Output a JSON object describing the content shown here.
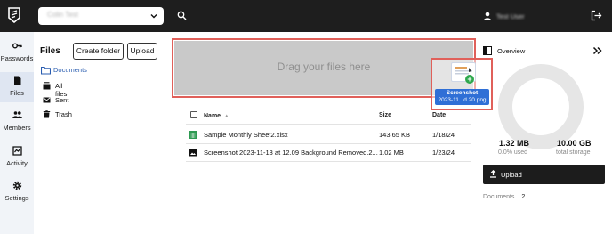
{
  "topbar": {
    "org_select_value": "Colin Test",
    "user_name": "Test User"
  },
  "rail": {
    "items": [
      {
        "label": "Passwords",
        "icon": "key-icon"
      },
      {
        "label": "Files",
        "icon": "file-icon",
        "active": true
      },
      {
        "label": "Members",
        "icon": "people-icon"
      },
      {
        "label": "Activity",
        "icon": "activity-icon"
      },
      {
        "label": "Settings",
        "icon": "gear-icon"
      }
    ]
  },
  "files_nav": {
    "title": "Files",
    "create_folder": "Create folder",
    "upload": "Upload",
    "items": [
      "Documents",
      "All files",
      "Sent",
      "Trash"
    ]
  },
  "dropzone": {
    "text": "Drag your files here",
    "dragged_file_label_line1": "Screenshot",
    "dragged_file_label_line2": "2023-11...d.20.png",
    "plus": "+"
  },
  "table": {
    "headers": {
      "name": "Name",
      "sort_arrow": "▴",
      "size": "Size",
      "date": "Date"
    },
    "rows": [
      {
        "name": "Sample Monthly Sheet2.xlsx",
        "size": "143.65 KB",
        "date": "1/18/24",
        "icon": "spreadsheet-icon"
      },
      {
        "name": "Screenshot 2023-11-13 at 12.09 Background Removed.2...",
        "size": "1.02 MB",
        "date": "1/23/24",
        "icon": "image-icon"
      }
    ]
  },
  "overview": {
    "title": "Overview",
    "used": "1.32 MB",
    "used_label": "0.0% used",
    "total": "10.00 GB",
    "total_label": "total storage",
    "upload": "Upload",
    "documents_label": "Documents",
    "documents_count": "2",
    "used_fraction": 0.0
  },
  "colors": {
    "topbar": "#1e1e1e",
    "accent": "#2a5db0",
    "highlight": "#e0605a",
    "dropzone": "#c9c9c9"
  }
}
